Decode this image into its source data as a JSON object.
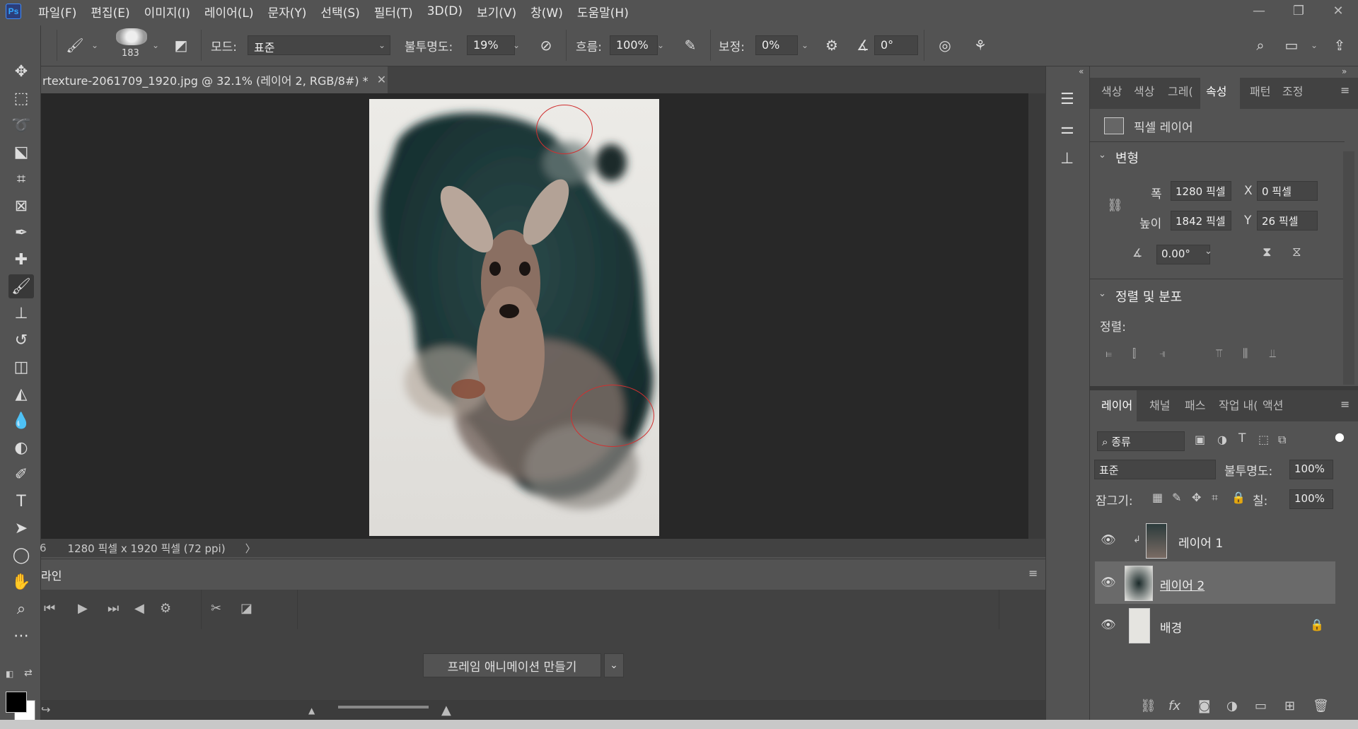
{
  "menu": [
    "파일(F)",
    "편집(E)",
    "이미지(I)",
    "레이어(L)",
    "문자(Y)",
    "선택(S)",
    "필터(T)",
    "3D(D)",
    "보기(V)",
    "창(W)",
    "도움말(H)"
  ],
  "options": {
    "brush_size": "183",
    "mode_label": "모드:",
    "mode_value": "표준",
    "opacity_label": "불투명도:",
    "opacity_value": "19%",
    "flow_label": "흐름:",
    "flow_value": "100%",
    "smoothing_label": "보정:",
    "smoothing_value": "0%",
    "angle_value": "0°"
  },
  "document": {
    "tab_title": "rtexture-2061709_1920.jpg @ 32.1% (레이어 2, RGB/8#) *",
    "status": "1280 픽셀 x 1920 픽셀 (72 ppi)",
    "zoom_stub": "6"
  },
  "timeline": {
    "title_stub": "라인",
    "create_button": "프레임 애니메이션 만들기"
  },
  "properties": {
    "tabs": [
      "색상",
      "색상",
      "그레(",
      "속성",
      "패턴",
      "조정"
    ],
    "active_tab": "속성",
    "layer_type": "픽셀 레이어",
    "transform_title": "변형",
    "width_label": "폭",
    "width_value": "1280 픽셀",
    "height_label": "높이",
    "height_value": "1842 픽셀",
    "x_label": "X",
    "x_value": "0 픽셀",
    "y_label": "Y",
    "y_value": "26 픽셀",
    "angle_value": "0.00°",
    "align_title": "정렬 및 분포",
    "align_label": "정렬:"
  },
  "layers_panel": {
    "tabs": [
      "레이어",
      "채널",
      "패스",
      "작업 내(",
      "액션"
    ],
    "filter_value": "종류",
    "blend_mode": "표준",
    "opacity_label": "불투명도:",
    "opacity_value": "100%",
    "lock_label": "잠그기:",
    "fill_label": "칠:",
    "fill_value": "100%",
    "layers": [
      {
        "name": "레이어 1"
      },
      {
        "name": "레이어 2"
      },
      {
        "name": "배경"
      }
    ]
  }
}
